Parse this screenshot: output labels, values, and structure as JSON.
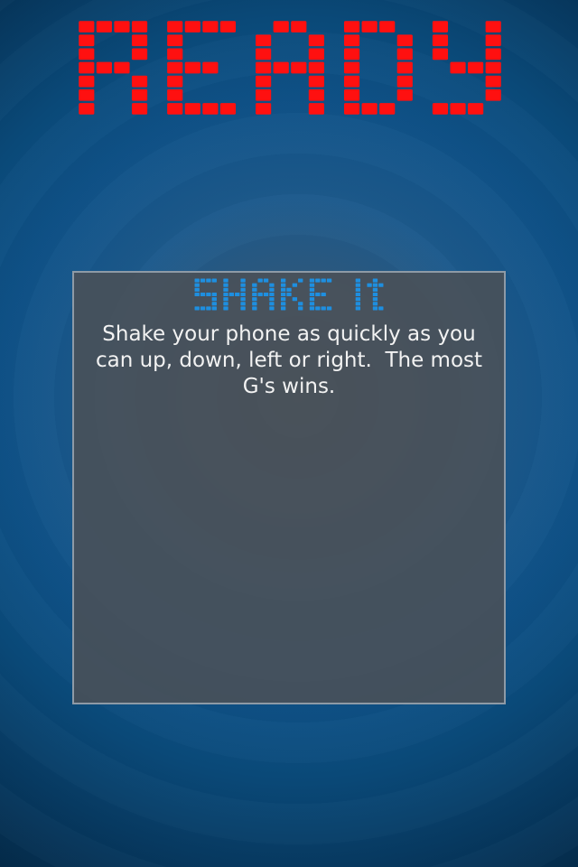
{
  "screen": {
    "title": "READY",
    "title_color": "#ff1010",
    "background_color": "#0b4f86"
  },
  "panel": {
    "heading": "Shake It",
    "heading_color": "#1e8fe0",
    "description": "Shake your phone as quickly as you can up, down, left or right.  The most G's wins."
  }
}
